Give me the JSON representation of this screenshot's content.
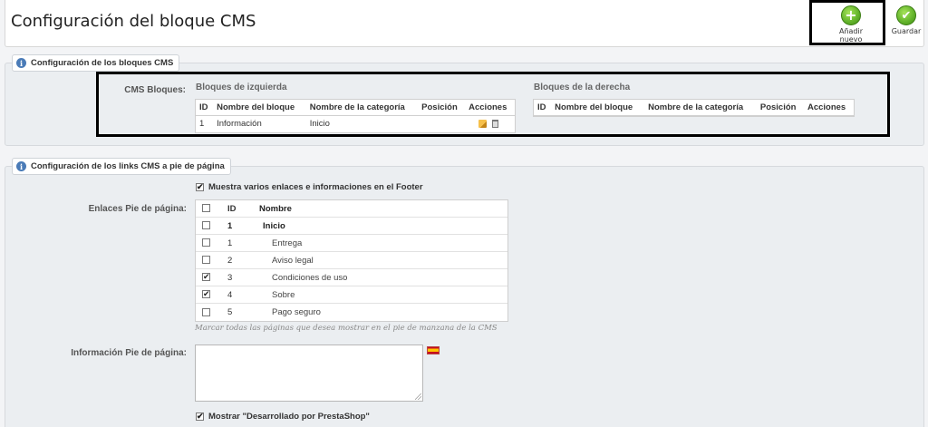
{
  "header": {
    "title": "Configuración del bloque CMS",
    "add_new_label": "Añadir nuevo",
    "save_label": "Guardar"
  },
  "cms_blocks_section": {
    "legend": "Configuración de los bloques CMS",
    "field_label": "CMS Bloques:",
    "left": {
      "heading": "Bloques de izquierda",
      "columns": [
        "ID",
        "Nombre del bloque",
        "Nombre de la categoría",
        "Posición",
        "Acciones"
      ],
      "rows": [
        {
          "id": "1",
          "name": "Información",
          "category": "Inicio",
          "position": ""
        }
      ]
    },
    "right": {
      "heading": "Bloques de la derecha",
      "columns": [
        "ID",
        "Nombre del bloque",
        "Nombre de la categoría",
        "Posición",
        "Acciones"
      ],
      "rows": []
    }
  },
  "footer_section": {
    "legend": "Configuración de los links CMS a pie de página",
    "show_links_label": "Muestra varios enlaces e informaciones en el Footer",
    "show_links_checked": true,
    "links_label": "Enlaces Pie de página:",
    "links_columns": {
      "id": "ID",
      "name": "Nombre"
    },
    "links": [
      {
        "id": "1",
        "name": "Inicio",
        "checked": false,
        "bold": true,
        "indent": 0
      },
      {
        "id": "1",
        "name": "Entrega",
        "checked": false,
        "bold": false,
        "indent": 1
      },
      {
        "id": "2",
        "name": "Aviso legal",
        "checked": false,
        "bold": false,
        "indent": 1
      },
      {
        "id": "3",
        "name": "Condiciones de uso",
        "checked": true,
        "bold": false,
        "indent": 1
      },
      {
        "id": "4",
        "name": "Sobre",
        "checked": true,
        "bold": false,
        "indent": 1
      },
      {
        "id": "5",
        "name": "Pago seguro",
        "checked": false,
        "bold": false,
        "indent": 1
      }
    ],
    "links_hint": "Marcar todas las páginas que desea mostrar en el pie de manzana de la CMS",
    "info_label": "Información Pie de página:",
    "info_value": "",
    "powered_by_label": "Mostrar \"Desarrollado por PrestaShop\"",
    "powered_by_checked": true
  }
}
